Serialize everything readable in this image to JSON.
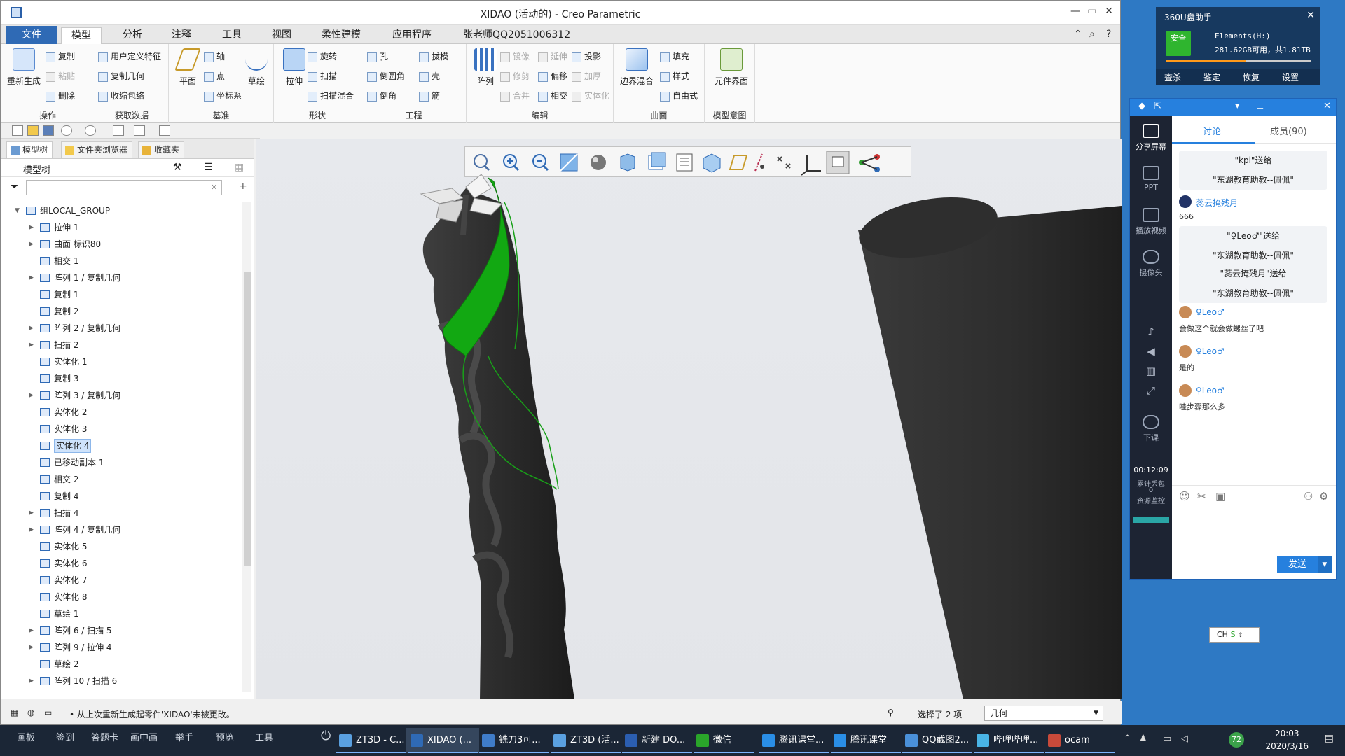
{
  "window": {
    "title": "XIDAO (活动的) - Creo Parametric"
  },
  "menu_tabs": [
    "文件",
    "模型",
    "分析",
    "注释",
    "工具",
    "视图",
    "柔性建模",
    "应用程序",
    "张老师QQ2051006312"
  ],
  "ribbon": {
    "groups": [
      "操作",
      "获取数据",
      "基准",
      "形状",
      "工程",
      "编辑",
      "曲面",
      "模型意图"
    ],
    "regenerate": "重新生成",
    "copy": "复制",
    "paste": "粘贴",
    "delete": "删除",
    "udf": "用户定义特征",
    "copy_geom": "复制几何",
    "shrinkwrap": "收缩包络",
    "plane": "平面",
    "axis": "轴",
    "point": "点",
    "csys": "坐标系",
    "sketch": "草绘",
    "extrude": "拉伸",
    "revolve": "旋转",
    "sweep": "扫描",
    "swept_blend": "扫描混合",
    "hole": "孔",
    "round": "倒圆角",
    "chamfer": "倒角",
    "draft": "拔模",
    "shell": "壳",
    "rib": "筋",
    "pattern": "阵列",
    "mirror": "镜像",
    "extend": "延伸",
    "project": "投影",
    "trim": "修剪",
    "offset": "偏移",
    "thicken": "加厚",
    "merge": "合并",
    "intersect": "相交",
    "solidify": "实体化",
    "boundary_blend": "边界混合",
    "fill": "填充",
    "style": "样式",
    "freestyle": "自由式",
    "component_interface": "元件界面"
  },
  "panel_tabs": [
    "模型树",
    "文件夹浏览器",
    "收藏夹"
  ],
  "tree_label": "模型树",
  "tree": [
    {
      "label": "组LOCAL_GROUP",
      "exp": "▼",
      "icon": "group-icon"
    },
    {
      "label": "拉伸 1",
      "exp": "▶",
      "icon": "extrude-icon"
    },
    {
      "label": "曲面 标识80",
      "exp": "▶",
      "icon": "surface-icon"
    },
    {
      "label": "相交 1",
      "exp": "",
      "icon": "intersect-icon"
    },
    {
      "label": "阵列 1 / 复制几何",
      "exp": "▶",
      "icon": "pattern-icon"
    },
    {
      "label": "复制 1",
      "exp": "",
      "icon": "copy-icon"
    },
    {
      "label": "复制 2",
      "exp": "",
      "icon": "copy-icon"
    },
    {
      "label": "阵列 2 / 复制几何",
      "exp": "▶",
      "icon": "pattern-icon"
    },
    {
      "label": "扫描 2",
      "exp": "▶",
      "icon": "sweep-icon"
    },
    {
      "label": "实体化 1",
      "exp": "",
      "icon": "solidify-icon"
    },
    {
      "label": "复制 3",
      "exp": "",
      "icon": "copy-icon"
    },
    {
      "label": "阵列 3 / 复制几何",
      "exp": "▶",
      "icon": "pattern-icon"
    },
    {
      "label": "实体化 2",
      "exp": "",
      "icon": "solidify-icon"
    },
    {
      "label": "实体化 3",
      "exp": "",
      "icon": "solidify-icon"
    },
    {
      "label": "实体化 4",
      "exp": "",
      "icon": "solidify-icon",
      "selected": true
    },
    {
      "label": "已移动副本 1",
      "exp": "",
      "icon": "moved-copy-icon"
    },
    {
      "label": "相交 2",
      "exp": "",
      "icon": "intersect-icon"
    },
    {
      "label": "复制 4",
      "exp": "",
      "icon": "copy-icon"
    },
    {
      "label": "扫描 4",
      "exp": "▶",
      "icon": "sweep-icon"
    },
    {
      "label": "阵列 4 / 复制几何",
      "exp": "▶",
      "icon": "pattern-icon"
    },
    {
      "label": "实体化 5",
      "exp": "",
      "icon": "solidify-icon"
    },
    {
      "label": "实体化 6",
      "exp": "",
      "icon": "solidify-icon"
    },
    {
      "label": "实体化 7",
      "exp": "",
      "icon": "solidify-icon"
    },
    {
      "label": "实体化 8",
      "exp": "",
      "icon": "solidify-icon"
    },
    {
      "label": "草绘 1",
      "exp": "",
      "icon": "sketch-icon"
    },
    {
      "label": "阵列 6 / 扫描 5",
      "exp": "▶",
      "icon": "pattern-icon"
    },
    {
      "label": "阵列 9 / 拉伸 4",
      "exp": "▶",
      "icon": "pattern-icon"
    },
    {
      "label": "草绘 2",
      "exp": "",
      "icon": "sketch-icon"
    },
    {
      "label": "阵列 10 / 扫描 6",
      "exp": "▶",
      "icon": "pattern-icon"
    }
  ],
  "status": {
    "message": "• 从上次重新生成起零件'XIDAO'未被更改。",
    "selection": "选择了 2 项",
    "filter": "几何"
  },
  "disk360": {
    "title": "360U盘助手",
    "badge": "安全",
    "drive": "Elements(H:)",
    "space": "281.62GB可用，共1.81TB",
    "used_fraction": 0.55,
    "actions": [
      "查杀",
      "鉴定",
      "恢复",
      "设置"
    ]
  },
  "tencent": {
    "sidebar": [
      "分享屏幕",
      "PPT",
      "播放视频",
      "摄像头",
      "下课"
    ],
    "timer": "00:12:09",
    "timer_label": "累计丢包",
    "loss": "0",
    "resource": "资源监控",
    "tabs": [
      "讨论",
      "成员(90)"
    ],
    "gifts": [
      {
        "line1": "\"kpi\"送给",
        "line2": "\"东湖教育助教--佩佩\""
      },
      {
        "line1": "\"♀Leo♂\"送给",
        "line2": "\"东湖教育助教--佩佩\""
      },
      {
        "line1": "\"蕊云掩残月\"送给",
        "line2": "\"东湖教育助教--佩佩\""
      }
    ],
    "messages": [
      {
        "name": "蕊云掩残月",
        "text": "666"
      },
      {
        "name": "♀Leo♂",
        "text": "会做这个就会做螺丝了吧"
      },
      {
        "name": "♀Leo♂",
        "text": "是的"
      },
      {
        "name": "♀Leo♂",
        "text": "哇步骤那么多"
      }
    ],
    "send": "发送"
  },
  "ime": "CH",
  "taskbar": {
    "classroom_tools": [
      "画板",
      "签到",
      "答题卡",
      "画中画",
      "举手",
      "预览",
      "工具"
    ],
    "items": [
      "ZT3D - C...",
      "XIDAO (...",
      "铣刀3可...",
      "ZT3D (活...",
      "新建 DO...",
      "微信",
      "腾讯课堂...",
      "腾讯课堂",
      "QQ截图2...",
      "哔哩哔哩...",
      "ocam"
    ],
    "badge": "72",
    "time": "20:03",
    "date": "2020/3/16"
  },
  "colors": {
    "accent": "#2f6ab5",
    "highlight_green": "#12a812",
    "tool_dark": "#2c2c2c"
  }
}
